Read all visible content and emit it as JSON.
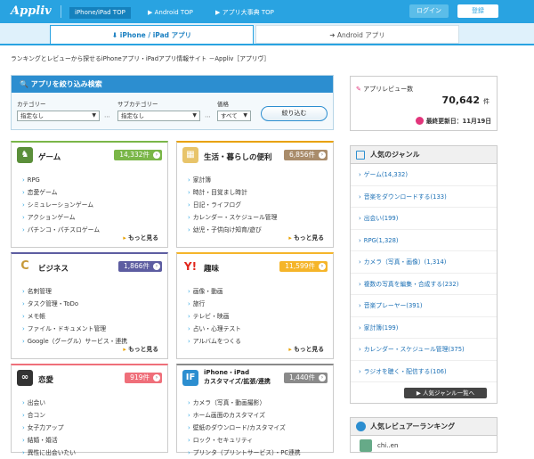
{
  "header": {
    "logo": "Appliv",
    "nav": [
      "iPhone/iPad TOP",
      "▶ Android TOP",
      "▶ アプリ大事典 TOP"
    ],
    "login": "ログイン",
    "register": "登録"
  },
  "platform_tabs": {
    "iphone": "⬇ iPhone / iPad アプリ",
    "android": "➜ Android アプリ"
  },
  "tagline": "ランキングとレビューから探せるiPhoneアプリ・iPadアプリ情報サイト －Appliv［アプリヴ］",
  "search": {
    "title": "アプリを絞り込み検索",
    "category_label": "カテゴリー",
    "category_value": "指定なし",
    "subcategory_label": "サブカテゴリー",
    "subcategory_value": "指定なし",
    "price_label": "価格",
    "price_value": "すべて",
    "submit": "絞り込む"
  },
  "categories": [
    {
      "title": "ゲーム",
      "count": "14,332件",
      "color": "#7ab648",
      "items": [
        "RPG",
        "恋愛ゲーム",
        "シミュレーションゲーム",
        "アクションゲーム",
        "パチンコ・パチスロゲーム"
      ],
      "more": "もっと見る"
    },
    {
      "title": "生活・暮らしの便利",
      "count": "6,856件",
      "color": "#a98c6b",
      "items": [
        "家計簿",
        "時計・目覚まし時計",
        "日記・ライフログ",
        "カレンダー・スケジュール管理",
        "幼児・子供向け知育/遊び"
      ],
      "more": "もっと見る"
    },
    {
      "title": "ビジネス",
      "count": "1,866件",
      "color": "#5d5da1",
      "items": [
        "名刺管理",
        "タスク管理・ToDo",
        "メモ帳",
        "ファイル・ドキュメント管理",
        "Google（グーグル）サービス・連携"
      ],
      "more": "もっと見る"
    },
    {
      "title": "趣味",
      "count": "11,599件",
      "color": "#f5b52a",
      "items": [
        "画像・動画",
        "旅行",
        "テレビ・映画",
        "占い・心理テスト",
        "アルバムをつくる"
      ],
      "more": "もっと見る"
    },
    {
      "title": "恋愛",
      "count": "919件",
      "color": "#ef6f7a",
      "items": [
        "出会い",
        "合コン",
        "女子力アップ",
        "結婚・婚活",
        "異性に出会いたい"
      ],
      "more": ""
    },
    {
      "title": "iPhone・iPad カスタマイズ/拡張/連携",
      "title1": "iPhone・iPad",
      "title2": "カスタマイズ/拡張/連携",
      "count": "1,440件",
      "color": "#8a8a8a",
      "items": [
        "カメラ（写真・動画撮影）",
        "ホーム画面のカスタマイズ",
        "壁紙のダウンロード/カスタマイズ",
        "ロック・セキュリティ",
        "プリンタ（プリントサービス）・PC連携"
      ],
      "more": ""
    }
  ],
  "review": {
    "label": "アプリレビュー数",
    "count": "70,642",
    "unit": "件",
    "updated": "最終更新日：11月19日"
  },
  "genres": {
    "title": "人気のジャンル",
    "items": [
      "ゲーム(14,332)",
      "音楽をダウンロードする(133)",
      "出会い(199)",
      "RPG(1,328)",
      "カメラ（写真・画像）(1,314)",
      "複数の写真を編集・合成する(232)",
      "音楽プレーヤー(391)",
      "家計簿(199)",
      "カレンダー・スケジュール管理(375)",
      "ラジオを聴く・配信する(106)"
    ],
    "all_button": "人気ジャンル一覧へ"
  },
  "ranking": {
    "title": "人気レビュアーランキング",
    "user": "chi..en"
  }
}
